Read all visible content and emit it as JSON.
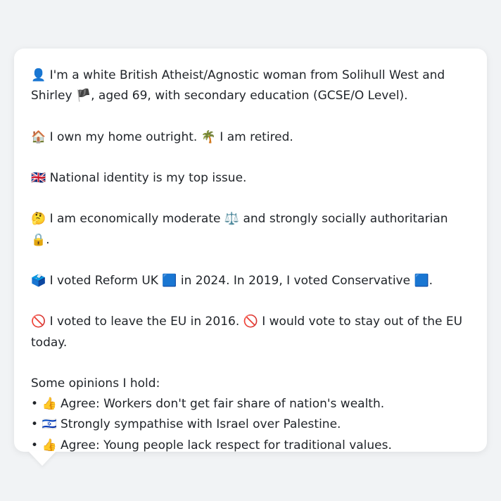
{
  "profile": {
    "identity": {
      "icon": "👤",
      "text_a": " I'm a white British Atheist/Agnostic woman from Solihull West and Shirley ",
      "flag": "🏴",
      "text_b": ", aged 69, with secondary education (GCSE/O Level)."
    },
    "home": {
      "icon": "🏠",
      "text_a": " I own my home outright. ",
      "icon2": "🌴",
      "text_b": " I am retired."
    },
    "issue": {
      "icon": "🇬🇧",
      "text": " National identity is my top issue."
    },
    "ideology": {
      "icon": "🤔",
      "text_a": " I am economically moderate ",
      "icon2": "⚖️",
      "text_b": " and strongly socially authoritarian ",
      "icon3": "🔒",
      "text_c": "."
    },
    "votes": {
      "icon": "🗳️",
      "text_a": " I voted Reform UK ",
      "icon2": "🟦",
      "text_b": " in 2024. In 2019, I voted Conservative ",
      "icon3": "🟦",
      "text_c": "."
    },
    "eu": {
      "icon": "🚫",
      "text_a": " I voted to leave the EU in 2016. ",
      "icon2": "🚫",
      "text_b": " I would vote to stay out of the EU today."
    },
    "opinions": {
      "heading": "Some opinions I hold:",
      "items": [
        {
          "bullet": "•",
          "icon": "👍",
          "text": " Agree: Workers don't get fair share of nation's wealth."
        },
        {
          "bullet": "•",
          "icon": "🇮🇱",
          "text": " Strongly sympathise with Israel over Palestine."
        },
        {
          "bullet": "•",
          "icon": "👍",
          "text": " Agree: Young people lack respect for traditional values."
        }
      ]
    }
  },
  "colors": {
    "page_background": "#f1f3f5",
    "bubble_background": "#ffffff",
    "text": "#1f2328"
  }
}
